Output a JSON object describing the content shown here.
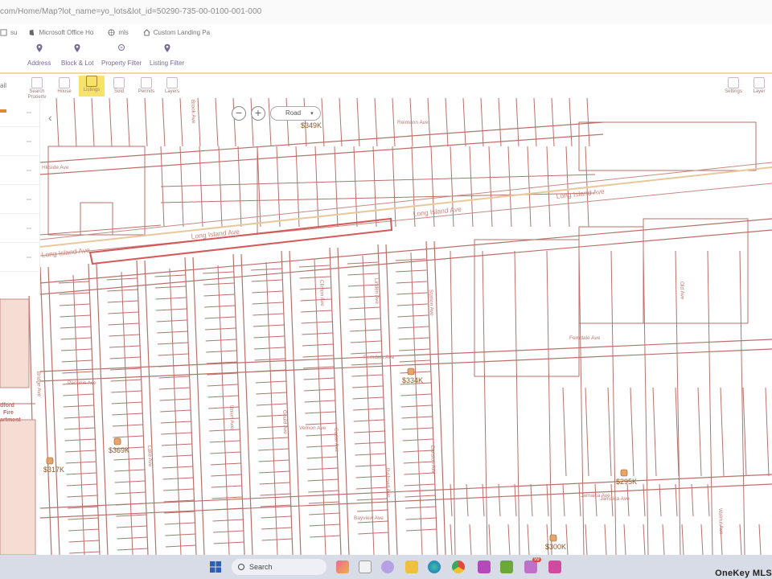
{
  "browser": {
    "url": "com/Home/Map?lot_name=yo_lots&lot_id=50290-735-00-0100-001-000",
    "bookmarks": [
      {
        "label": "su",
        "icon": "bookmark-icon"
      },
      {
        "label": "Microsoft Office Ho",
        "icon": "office-icon"
      },
      {
        "label": "mls",
        "icon": "globe-icon"
      },
      {
        "label": "Custom Landing Pa",
        "icon": "home-icon"
      }
    ]
  },
  "search_tabs": [
    {
      "label": "Address",
      "icon": "map-pin-icon"
    },
    {
      "label": "Block & Lot",
      "icon": "map-pin-icon"
    },
    {
      "label": "Property Filter",
      "icon": "filter-icon"
    },
    {
      "label": "Listing Filter",
      "icon": "map-pin-icon"
    }
  ],
  "toolbar": {
    "home_label": "ail",
    "items": [
      {
        "label": "Search Property",
        "icon": "search-property-icon"
      },
      {
        "label": "House",
        "icon": "house-icon"
      },
      {
        "label": "Listings",
        "icon": "listings-icon",
        "active": true
      },
      {
        "label": "Sold",
        "icon": "sold-icon"
      },
      {
        "label": "Permits",
        "icon": "permits-icon"
      },
      {
        "label": "Layers",
        "icon": "layers-icon"
      },
      {
        "label": "Settings",
        "icon": "settings-icon"
      },
      {
        "label": "Layer",
        "icon": "layer-icon"
      }
    ]
  },
  "map": {
    "type_select": "Road",
    "zoom_out": "−",
    "zoom_in": "+",
    "collapse": "‹",
    "streets": {
      "lia_top": "Long Island Ave",
      "lia_mid": "Long Island Ave",
      "lia_left": "Long Island Ave",
      "lia_left2": "Long Island Ave",
      "reimann": "Reimann Ave",
      "hillside": "Hillside Ave",
      "peconic": "Peconic Ave",
      "ferndale": "Ferndale Ave",
      "ferndale2": "Ferndale Ave",
      "vernon": "Vernon Ave",
      "bayview": "Bayview Ave",
      "jamaica": "Jamaica Ave",
      "jamaica2": "Jamaica Ave",
      "lake": "Lake Ave",
      "union": "Union Ave",
      "gould": "Gould Ave",
      "cedar": "Cedar Ave",
      "railroad": "Railroad Ave",
      "division": "Division Ave",
      "station": "Station Ave",
      "linden": "Linden Ave",
      "clinton": "Clinton Ave",
      "brook": "Brook Ave",
      "old": "Old Ave",
      "bridge": "Bridge Ave",
      "walnut": "Walnut Ave"
    },
    "poi": {
      "line1": "dford",
      "line2": "Fire",
      "line3": "artment"
    },
    "listings": [
      {
        "price": "$349K"
      },
      {
        "price": "$334K"
      },
      {
        "price": "$369K"
      },
      {
        "price": "$317K"
      },
      {
        "price": "$295K"
      },
      {
        "price": "$300K"
      }
    ]
  },
  "taskbar": {
    "search_label": "Search",
    "brand": "OneKey MLS",
    "badge": "99"
  },
  "colors": {
    "parcel": "#b9706a",
    "road": "#c48a84",
    "highlight": "#d45a5a",
    "marker": "#e9a46a",
    "active_tab": "#f6e46a"
  }
}
